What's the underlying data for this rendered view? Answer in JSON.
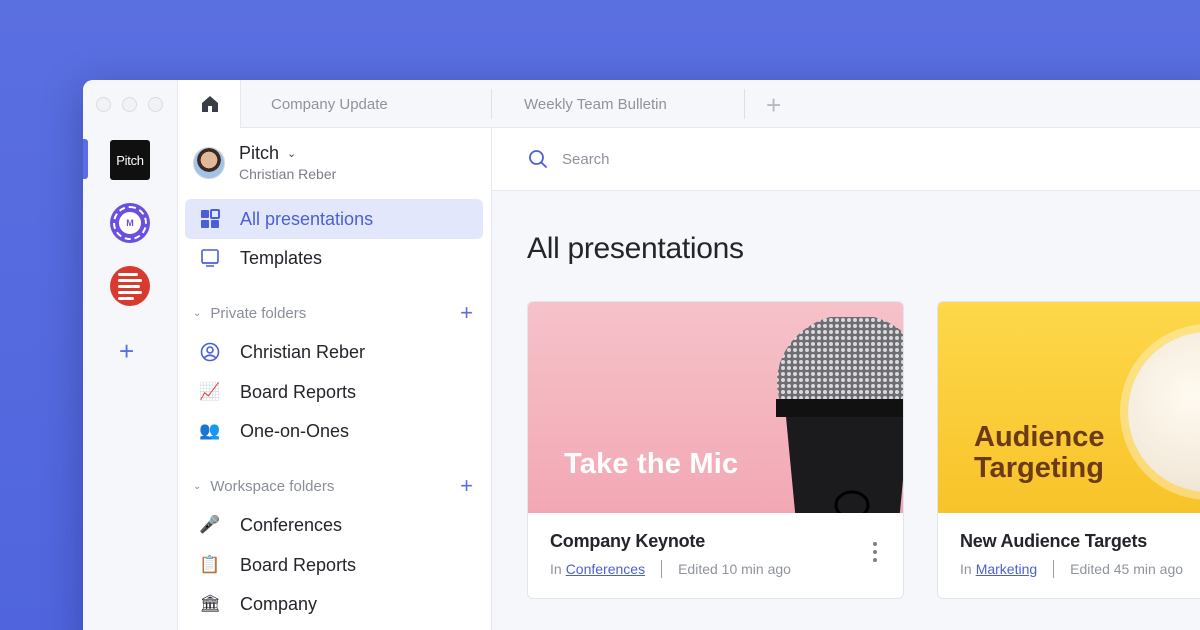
{
  "rail": {
    "workspaces": [
      {
        "label": "Pitch",
        "icon": "pitch-logo"
      },
      {
        "label": "M",
        "icon": "badge-logo"
      },
      {
        "label": "",
        "icon": "lines-logo"
      }
    ],
    "add_icon": "plus-icon"
  },
  "tabs": [
    {
      "label": "Company Update"
    },
    {
      "label": "Weekly Team Bulletin"
    }
  ],
  "account": {
    "workspace": "Pitch",
    "user": "Christian Reber"
  },
  "nav": {
    "all_presentations": "All presentations",
    "templates": "Templates"
  },
  "private_folders": {
    "heading": "Private folders",
    "items": [
      {
        "label": "Christian Reber",
        "icon": "user-circle-icon"
      },
      {
        "label": "Board Reports",
        "icon": "chart-icon"
      },
      {
        "label": "One-on-Ones",
        "icon": "people-icon"
      }
    ]
  },
  "workspace_folders": {
    "heading": "Workspace folders",
    "items": [
      {
        "label": "Conferences",
        "icon": "microphone-icon"
      },
      {
        "label": "Board Reports",
        "icon": "clipboard-icon"
      },
      {
        "label": "Company",
        "icon": "bank-icon"
      }
    ]
  },
  "search": {
    "placeholder": "Search"
  },
  "main": {
    "title": "All presentations"
  },
  "cards": [
    {
      "thumb_text": "Take the Mic",
      "title": "Company Keynote",
      "in_label": "In",
      "folder": "Conferences",
      "edited": "Edited 10 min ago"
    },
    {
      "thumb_text_line1": "Audience",
      "thumb_text_line2": "Targeting",
      "title": "New Audience Targets",
      "in_label": "In",
      "folder": "Marketing",
      "edited": "Edited 45 min ago"
    }
  ],
  "colors": {
    "background": "#5a6fe0",
    "accent": "#4b5fd6",
    "active_nav_bg": "#e3e7fb"
  }
}
